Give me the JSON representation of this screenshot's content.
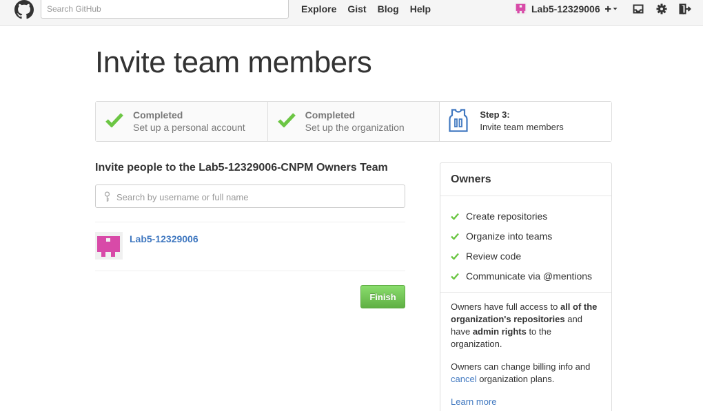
{
  "header": {
    "search_placeholder": "Search GitHub",
    "nav": [
      "Explore",
      "Gist",
      "Blog",
      "Help"
    ],
    "username": "Lab5-12329006"
  },
  "page_title": "Invite team members",
  "steps": [
    {
      "status": "Completed",
      "label": "Set up a personal account"
    },
    {
      "status": "Completed",
      "label": "Set up the organization"
    },
    {
      "status": "Step 3:",
      "label": "Invite team members"
    }
  ],
  "invite": {
    "title": "Invite people to the Lab5-12329006-CNPM Owners Team",
    "search_placeholder": "Search by username or full name",
    "member_name": "Lab5-12329006",
    "finish_label": "Finish"
  },
  "owners": {
    "title": "Owners",
    "permissions": [
      "Create repositories",
      "Organize into teams",
      "Review code",
      "Communicate via @mentions"
    ],
    "desc1": {
      "a": "Owners have full access to ",
      "b": "all of the organization's repositories",
      "c": " and have ",
      "d": "admin rights",
      "e": " to the organization."
    },
    "desc2": {
      "a": "Owners can change billing info and ",
      "link": "cancel",
      "b": " organization plans."
    },
    "learn_more": "Learn more"
  },
  "colors": {
    "accent_link": "#4078c0",
    "check_green": "#6cc644",
    "avatar_pink": "#d84aa8"
  }
}
